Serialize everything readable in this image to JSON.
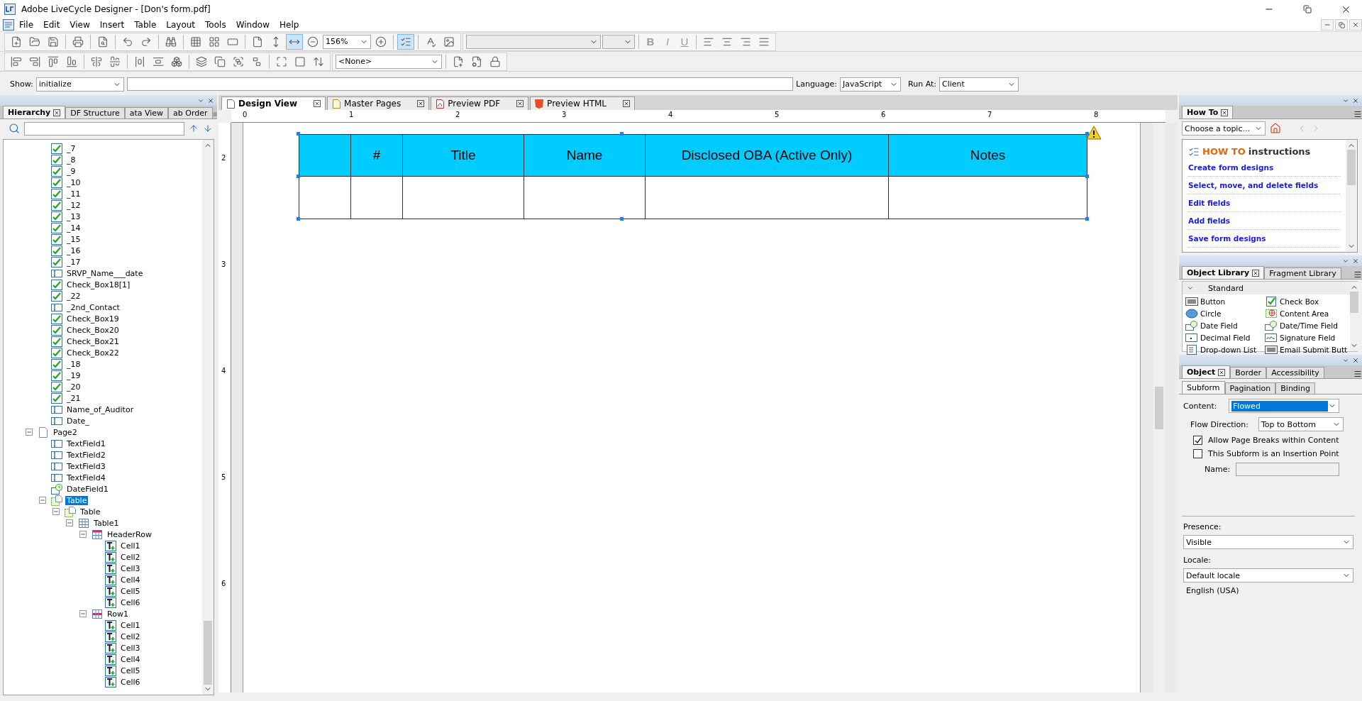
{
  "window": {
    "title": "Adobe LiveCycle Designer - [Don's form.pdf]"
  },
  "menu": [
    "File",
    "Edit",
    "View",
    "Insert",
    "Table",
    "Layout",
    "Tools",
    "Window",
    "Help"
  ],
  "toolbar": {
    "zoom": "156%",
    "text_style_buttons": [
      "B",
      "I",
      "U"
    ],
    "style_select": "<None>"
  },
  "script_bar": {
    "show_label": "Show:",
    "event": "initialize",
    "language_label": "Language:",
    "language": "JavaScript",
    "run_at_label": "Run At:",
    "run_at": "Client"
  },
  "hierarchy": {
    "tabs": [
      {
        "label": "Hierarchy",
        "selected": true
      },
      {
        "label": "DF Structure",
        "selected": false
      },
      {
        "label": "ata View",
        "selected": false
      },
      {
        "label": "ab Order",
        "selected": false
      }
    ],
    "continued_items": [
      {
        "label": "_7",
        "kind": "check",
        "selected": false
      },
      {
        "label": "_8",
        "kind": "check",
        "selected": false
      },
      {
        "label": "_9",
        "kind": "check",
        "selected": false
      },
      {
        "label": "_10",
        "kind": "check",
        "selected": false
      },
      {
        "label": "_11",
        "kind": "check",
        "selected": false
      },
      {
        "label": "_12",
        "kind": "check",
        "selected": false
      },
      {
        "label": "_13",
        "kind": "check",
        "selected": false
      },
      {
        "label": "_14",
        "kind": "check",
        "selected": false
      },
      {
        "label": "_15",
        "kind": "check",
        "selected": false
      },
      {
        "label": "_16",
        "kind": "check",
        "selected": false
      },
      {
        "label": "_17",
        "kind": "check",
        "selected": false
      },
      {
        "label": "SRVP_Name___date",
        "kind": "text",
        "selected": false
      },
      {
        "label": "Check_Box18[1]",
        "kind": "check",
        "selected": false
      },
      {
        "label": "_22",
        "kind": "check",
        "selected": false
      },
      {
        "label": "_2nd_Contact",
        "kind": "text",
        "selected": false
      },
      {
        "label": "Check_Box19",
        "kind": "check",
        "selected": false
      },
      {
        "label": "Check_Box20",
        "kind": "check",
        "selected": false
      },
      {
        "label": "Check_Box21",
        "kind": "check",
        "selected": false
      },
      {
        "label": "Check_Box22",
        "kind": "check",
        "selected": false
      },
      {
        "label": "_18",
        "kind": "check",
        "selected": false
      },
      {
        "label": "_19",
        "kind": "check",
        "selected": false
      },
      {
        "label": "_20",
        "kind": "check",
        "selected": false
      },
      {
        "label": "_21",
        "kind": "check",
        "selected": false
      },
      {
        "label": "Name_of_Auditor",
        "kind": "text",
        "selected": false
      },
      {
        "label": "Date_",
        "kind": "text",
        "selected": false
      }
    ],
    "items": [
      {
        "label": "Page2",
        "kind": "page",
        "selected": false,
        "expanded": true,
        "children": [
          {
            "label": "TextField1",
            "kind": "text",
            "selected": false
          },
          {
            "label": "TextField2",
            "kind": "text",
            "selected": false
          },
          {
            "label": "TextField3",
            "kind": "text",
            "selected": false
          },
          {
            "label": "TextField4",
            "kind": "text",
            "selected": false
          },
          {
            "label": "DateField1",
            "kind": "date",
            "selected": false
          },
          {
            "label": "Table",
            "kind": "subform",
            "selected": true,
            "expanded": true,
            "children": [
              {
                "label": "Table",
                "kind": "subform",
                "selected": false,
                "expanded": true,
                "children": [
                  {
                    "label": "Table1",
                    "kind": "table",
                    "selected": false,
                    "expanded": true,
                    "children": [
                      {
                        "label": "HeaderRow",
                        "kind": "header_row",
                        "selected": false,
                        "expanded": true,
                        "children": [
                          {
                            "label": "Cell1",
                            "kind": "cell",
                            "selected": false
                          },
                          {
                            "label": "Cell2",
                            "kind": "cell",
                            "selected": false
                          },
                          {
                            "label": "Cell3",
                            "kind": "cell",
                            "selected": false
                          },
                          {
                            "label": "Cell4",
                            "kind": "cell",
                            "selected": false
                          },
                          {
                            "label": "Cell5",
                            "kind": "cell",
                            "selected": false
                          },
                          {
                            "label": "Cell6",
                            "kind": "cell",
                            "selected": false
                          }
                        ]
                      },
                      {
                        "label": "Row1",
                        "kind": "row",
                        "selected": false,
                        "expanded": true,
                        "children": [
                          {
                            "label": "Cell1",
                            "kind": "cell",
                            "selected": false
                          },
                          {
                            "label": "Cell2",
                            "kind": "cell",
                            "selected": false
                          },
                          {
                            "label": "Cell3",
                            "kind": "cell",
                            "selected": false
                          },
                          {
                            "label": "Cell4",
                            "kind": "cell",
                            "selected": false
                          },
                          {
                            "label": "Cell5",
                            "kind": "cell",
                            "selected": false
                          },
                          {
                            "label": "Cell6",
                            "kind": "cell",
                            "selected": false
                          }
                        ]
                      }
                    ]
                  }
                ]
              }
            ]
          }
        ]
      }
    ]
  },
  "editor": {
    "tabs": [
      {
        "label": "Design View",
        "kind": "design",
        "selected": true
      },
      {
        "label": "Master Pages",
        "kind": "pages",
        "selected": false
      },
      {
        "label": "Preview PDF",
        "kind": "pdf",
        "selected": false
      },
      {
        "label": "Preview HTML",
        "kind": "html",
        "selected": false
      }
    ],
    "ruler": {
      "horizontal": [
        "0",
        "1",
        "2",
        "3",
        "4",
        "5",
        "6",
        "7",
        "8"
      ],
      "vertical": [
        "2",
        "3",
        "4",
        "5",
        "6"
      ]
    },
    "table": {
      "columns": [
        {},
        {
          "label": "#"
        },
        {
          "label": "Title"
        },
        {
          "label": "Name"
        },
        {
          "label": "Disclosed OBA (Active Only)"
        },
        {
          "label": "Notes"
        }
      ],
      "warning": true
    }
  },
  "how_to": {
    "tabs": [
      {
        "label": "How To",
        "selected": true
      }
    ],
    "topic": "Choose a topic...",
    "heading_accent": "HOW TO",
    "heading": "instructions",
    "links": [
      "Create form designs",
      "Select, move, and delete fields",
      "Edit fields",
      "Add fields",
      "Save form designs"
    ]
  },
  "object_library": {
    "tabs": [
      {
        "label": "Object Library",
        "selected": true
      },
      {
        "label": "Fragment Library",
        "selected": false
      }
    ],
    "group": "Standard",
    "items": [
      {
        "label": "Button",
        "kind": "button"
      },
      {
        "label": "Check Box",
        "kind": "check"
      },
      {
        "label": "Circle",
        "kind": "circle"
      },
      {
        "label": "Content Area",
        "kind": "area"
      },
      {
        "label": "Date Field",
        "kind": "date"
      },
      {
        "label": "Date/Time Field",
        "kind": "date"
      },
      {
        "label": "Decimal Field",
        "kind": "decimal"
      },
      {
        "label": "Signature Field",
        "kind": "signature"
      },
      {
        "label": "Drop-down List",
        "kind": "list"
      },
      {
        "label": "Email Submit Butt",
        "kind": "button"
      }
    ]
  },
  "object_panel": {
    "tabs": [
      {
        "label": "Object",
        "selected": true
      },
      {
        "label": "Border",
        "selected": false
      },
      {
        "label": "Accessibility",
        "selected": false
      }
    ],
    "subtabs": [
      {
        "label": "Subform",
        "selected": true
      },
      {
        "label": "Pagination",
        "selected": false
      },
      {
        "label": "Binding",
        "selected": false
      }
    ],
    "content": {
      "label": "Content:",
      "value": "Flowed",
      "selected": true
    },
    "flow_direction": {
      "label": "Flow Direction:",
      "value": "Top to Bottom"
    },
    "checkboxes": [
      {
        "label": "Allow Page Breaks within Content",
        "checked": true
      },
      {
        "label": "This Subform is an Insertion Point",
        "checked": false
      }
    ],
    "name": {
      "label": "Name:",
      "disabled": true
    },
    "presence": {
      "label": "Presence:",
      "value": "Visible"
    },
    "locale": {
      "label": "Locale:",
      "value": "Default locale"
    },
    "locale_note": "English (USA)"
  }
}
